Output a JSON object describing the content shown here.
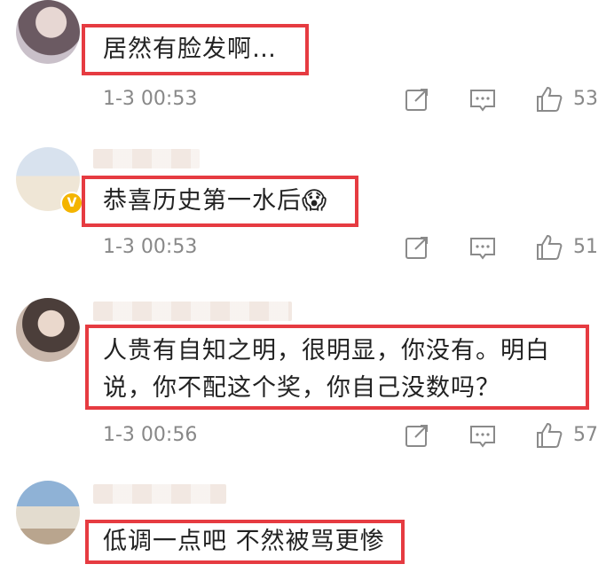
{
  "comments": [
    {
      "text_lines": [
        "居然有脸发啊…"
      ],
      "time": "1-3 00:53",
      "likes": "53",
      "avatar_colors": [
        "#c9c0c9",
        "#6b5a62"
      ]
    },
    {
      "text_lines": [
        "恭喜历史第一水后😱"
      ],
      "time": "1-3 00:53",
      "likes": "51",
      "avatar_colors": [
        "#d8e2ee",
        "#c8a66e"
      ],
      "badge": "V"
    },
    {
      "text_lines": [
        "人贵有自知之明，很明显，你没有。明白",
        "说，你不配这个奖，你自己没数吗？"
      ],
      "time": "1-3 00:56",
      "likes": "57",
      "avatar_colors": [
        "#c9b7ab",
        "#4b3e3a"
      ]
    },
    {
      "text_lines": [
        "低调一点吧 不然被骂更惨"
      ],
      "time": "",
      "likes": "",
      "avatar_colors": [
        "#8fb2d6",
        "#e3dccf"
      ]
    }
  ],
  "icons": {
    "share": "share-icon",
    "comment": "comment-icon",
    "like": "thumbs-up-icon"
  },
  "colors": {
    "highlight": "#e63b41",
    "meta_text": "#888888",
    "body_text": "#222222"
  }
}
